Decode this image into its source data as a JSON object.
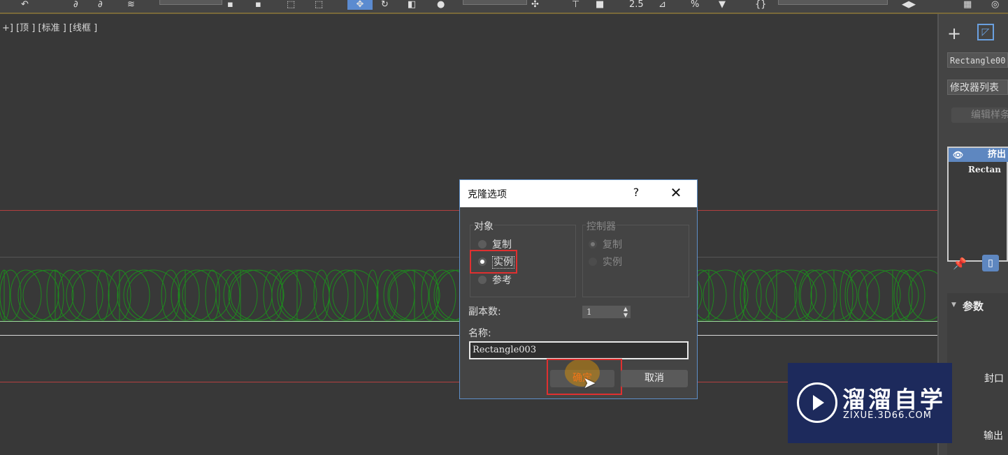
{
  "viewport": {
    "label": "+] [顶 ] [标准 ] [线框 ]"
  },
  "dialog": {
    "title": "克隆选项",
    "help": "?",
    "close": "✕",
    "object_group": {
      "title": "对象",
      "options": [
        {
          "label": "复制",
          "checked": false
        },
        {
          "label": "实例",
          "checked": true
        },
        {
          "label": "参考",
          "checked": false
        }
      ]
    },
    "controller_group": {
      "title": "控制器",
      "options": [
        {
          "label": "复制",
          "checked": true
        },
        {
          "label": "实例",
          "checked": false
        }
      ]
    },
    "copies_label": "副本数:",
    "copies_value": "1",
    "name_label": "名称:",
    "name_value": "Rectangle003",
    "ok_label": "确定",
    "cancel_label": "取消"
  },
  "panel": {
    "object_name": "Rectangle00",
    "modifier_list": "修改器列表",
    "edit_button": "编辑样条",
    "stack_selected": "挤出",
    "stack_base": "Rectan",
    "params_title": "参数",
    "cap_label": "封口",
    "output_label": "输出"
  },
  "watermark": {
    "title": "溜溜自学",
    "subtitle": "ZIXUE.3D66.COM"
  },
  "colors": {
    "dialog_border": "#5e8fc9",
    "highlight": "#e03030",
    "wireframe": "#1e8a1e",
    "stack_selected": "#5e87c0",
    "watermark_bg": "#1d2a5c"
  }
}
